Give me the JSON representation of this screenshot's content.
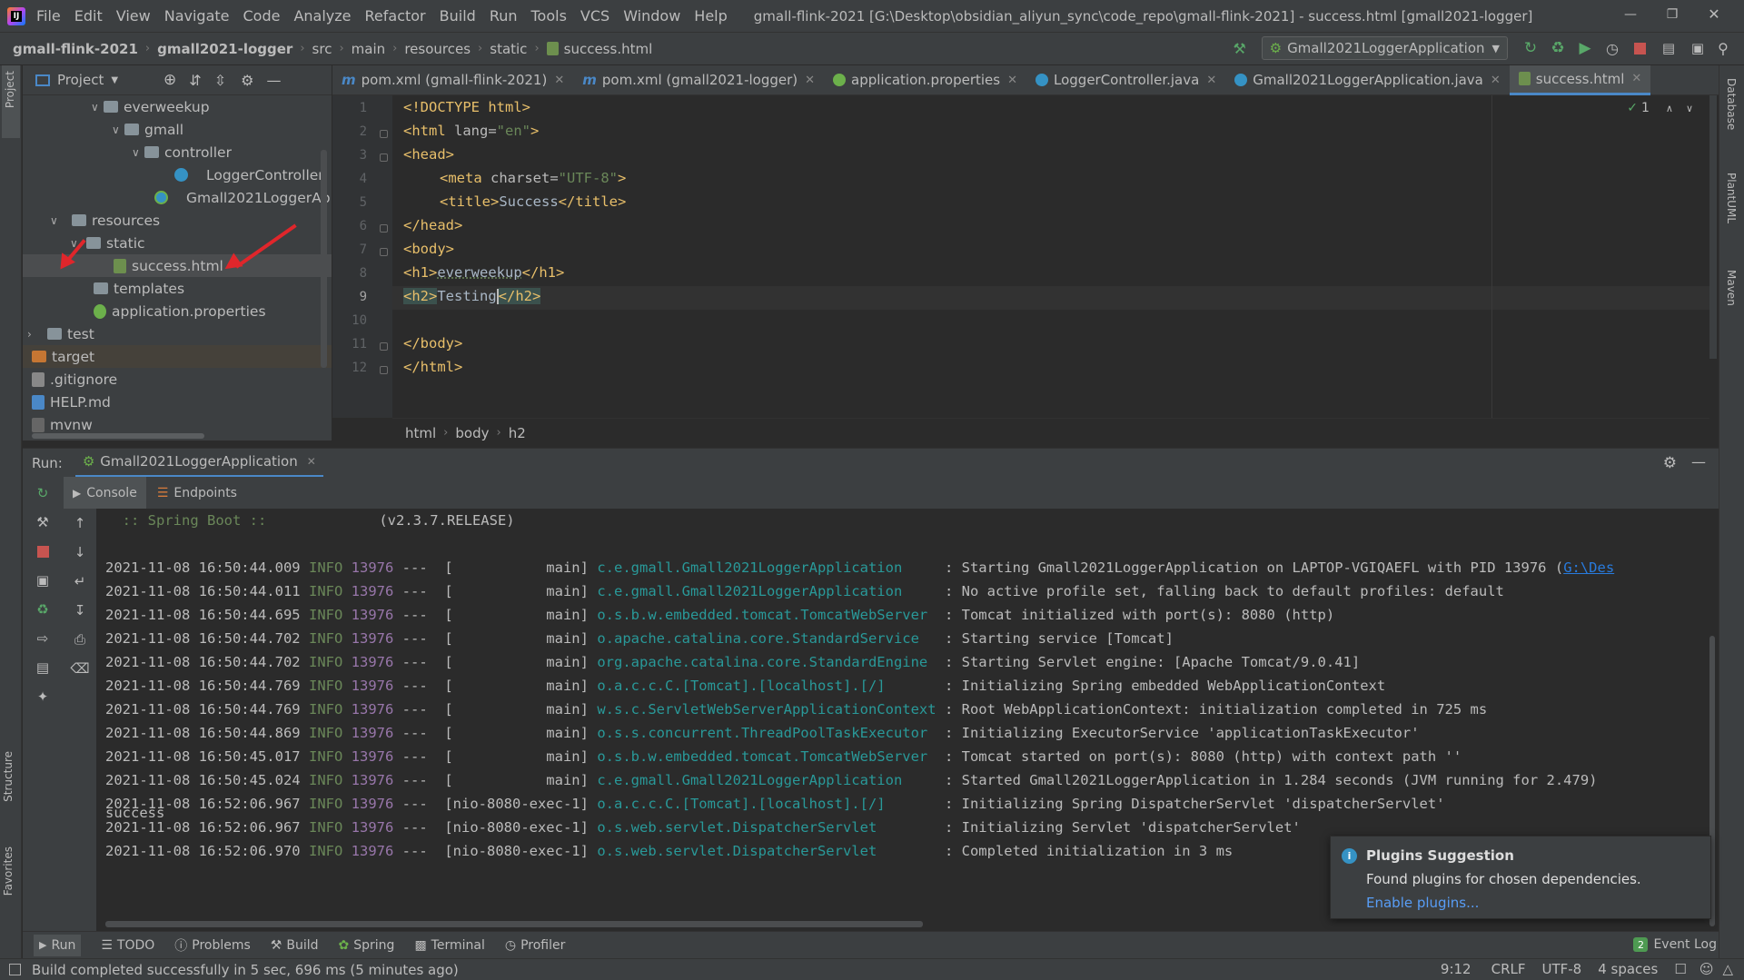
{
  "menu": [
    "File",
    "Edit",
    "View",
    "Navigate",
    "Code",
    "Analyze",
    "Refactor",
    "Build",
    "Run",
    "Tools",
    "VCS",
    "Window",
    "Help"
  ],
  "window_title": "gmall-flink-2021 [G:\\Desktop\\obsidian_aliyun_sync\\code_repo\\gmall-flink-2021] - success.html [gmall2021-logger]",
  "breadcrumb": [
    "gmall-flink-2021",
    "gmall2021-logger",
    "src",
    "main",
    "resources",
    "static",
    "success.html"
  ],
  "run_config": "Gmall2021LoggerApplication",
  "project": {
    "title": "Project",
    "tree": [
      {
        "label": "everweekup",
        "kind": "folder"
      },
      {
        "label": "gmall",
        "kind": "folder"
      },
      {
        "label": "controller",
        "kind": "folder"
      },
      {
        "label": "LoggerController",
        "kind": "class"
      },
      {
        "label": "Gmall2021LoggerAp",
        "kind": "class"
      },
      {
        "label": "resources",
        "kind": "folder"
      },
      {
        "label": "static",
        "kind": "folder"
      },
      {
        "label": "success.html",
        "kind": "html"
      },
      {
        "label": "templates",
        "kind": "folder"
      },
      {
        "label": "application.properties",
        "kind": "props"
      },
      {
        "label": "test",
        "kind": "folder"
      },
      {
        "label": "target",
        "kind": "folder-orange"
      },
      {
        "label": ".gitignore",
        "kind": "file"
      },
      {
        "label": "HELP.md",
        "kind": "file"
      },
      {
        "label": "mvnw",
        "kind": "file"
      }
    ]
  },
  "tabs": [
    {
      "label": "pom.xml (gmall-flink-2021)",
      "icon": "m"
    },
    {
      "label": "pom.xml (gmall2021-logger)",
      "icon": "m"
    },
    {
      "label": "application.properties",
      "icon": "props"
    },
    {
      "label": "LoggerController.java",
      "icon": "class"
    },
    {
      "label": "Gmall2021LoggerApplication.java",
      "icon": "class"
    },
    {
      "label": "success.html",
      "icon": "html",
      "active": true
    }
  ],
  "editor": {
    "line_numbers": [
      "1",
      "2",
      "3",
      "4",
      "5",
      "6",
      "7",
      "8",
      "9",
      "10",
      "11",
      "12"
    ],
    "problems_count": "1",
    "breadcrumb": [
      "html",
      "body",
      "h2"
    ]
  },
  "code": {
    "l1": "<!DOCTYPE html>",
    "l2_open": "<html ",
    "l2_attr": "lang=",
    "l2_val": "\"en\"",
    "l2_close": ">",
    "l3": "<head>",
    "l4_open": "<meta ",
    "l4_attr": "charset=",
    "l4_val": "\"UTF-8\"",
    "l4_close": ">",
    "l5_open": "<title>",
    "l5_text": "Success",
    "l5_close": "</title>",
    "l6": "</head>",
    "l7": "<body>",
    "l8_open": "<h1>",
    "l8_text": "everweekup",
    "l8_close": "</h1>",
    "l9_open": "<h2>",
    "l9_text": "Testing",
    "l9_close": "</h2>",
    "l11": "</body>",
    "l12": "</html>"
  },
  "run": {
    "label": "Run:",
    "config_tab": "Gmall2021LoggerApplication",
    "tabs": [
      "Console",
      "Endpoints"
    ],
    "banner_left": "  :: Spring Boot ::",
    "banner_right": "(v2.3.7.RELEASE)",
    "logs": [
      {
        "ts": "2021-11-08 16:50:44.009",
        "lv": "INFO",
        "pid": "13976",
        "th": "---  [           main]",
        "lg": "c.e.gmall.Gmall2021LoggerApplication    ",
        "msg": ": Starting Gmall2021LoggerApplication on LAPTOP-VGIQAEFL with PID 13976 (",
        "link": "G:\\Des"
      },
      {
        "ts": "2021-11-08 16:50:44.011",
        "lv": "INFO",
        "pid": "13976",
        "th": "---  [           main]",
        "lg": "c.e.gmall.Gmall2021LoggerApplication    ",
        "msg": ": No active profile set, falling back to default profiles: default",
        "link": ""
      },
      {
        "ts": "2021-11-08 16:50:44.695",
        "lv": "INFO",
        "pid": "13976",
        "th": "---  [           main]",
        "lg": "o.s.b.w.embedded.tomcat.TomcatWebServer ",
        "msg": ": Tomcat initialized with port(s): 8080 (http)",
        "link": ""
      },
      {
        "ts": "2021-11-08 16:50:44.702",
        "lv": "INFO",
        "pid": "13976",
        "th": "---  [           main]",
        "lg": "o.apache.catalina.core.StandardService  ",
        "msg": ": Starting service [Tomcat]",
        "link": ""
      },
      {
        "ts": "2021-11-08 16:50:44.702",
        "lv": "INFO",
        "pid": "13976",
        "th": "---  [           main]",
        "lg": "org.apache.catalina.core.StandardEngine ",
        "msg": ": Starting Servlet engine: [Apache Tomcat/9.0.41]",
        "link": ""
      },
      {
        "ts": "2021-11-08 16:50:44.769",
        "lv": "INFO",
        "pid": "13976",
        "th": "---  [           main]",
        "lg": "o.a.c.c.C.[Tomcat].[localhost].[/]      ",
        "msg": ": Initializing Spring embedded WebApplicationContext",
        "link": ""
      },
      {
        "ts": "2021-11-08 16:50:44.769",
        "lv": "INFO",
        "pid": "13976",
        "th": "---  [           main]",
        "lg": "w.s.c.ServletWebServerApplicationContext",
        "msg": ": Root WebApplicationContext: initialization completed in 725 ms",
        "link": ""
      },
      {
        "ts": "2021-11-08 16:50:44.869",
        "lv": "INFO",
        "pid": "13976",
        "th": "---  [           main]",
        "lg": "o.s.s.concurrent.ThreadPoolTaskExecutor ",
        "msg": ": Initializing ExecutorService 'applicationTaskExecutor'",
        "link": ""
      },
      {
        "ts": "2021-11-08 16:50:45.017",
        "lv": "INFO",
        "pid": "13976",
        "th": "---  [           main]",
        "lg": "o.s.b.w.embedded.tomcat.TomcatWebServer ",
        "msg": ": Tomcat started on port(s): 8080 (http) with context path ''",
        "link": ""
      },
      {
        "ts": "2021-11-08 16:50:45.024",
        "lv": "INFO",
        "pid": "13976",
        "th": "---  [           main]",
        "lg": "c.e.gmall.Gmall2021LoggerApplication    ",
        "msg": ": Started Gmall2021LoggerApplication in 1.284 seconds (JVM running for 2.479)",
        "link": ""
      },
      {
        "ts": "2021-11-08 16:52:06.967",
        "lv": "INFO",
        "pid": "13976",
        "th": "---  [nio-8080-exec-1]",
        "lg": "o.a.c.c.C.[Tomcat].[localhost].[/]      ",
        "msg": ": Initializing Spring DispatcherServlet 'dispatcherServlet'",
        "link": ""
      },
      {
        "ts": "2021-11-08 16:52:06.967",
        "lv": "INFO",
        "pid": "13976",
        "th": "---  [nio-8080-exec-1]",
        "lg": "o.s.web.servlet.DispatcherServlet       ",
        "msg": ": Initializing Servlet 'dispatcherServlet'",
        "link": ""
      },
      {
        "ts": "2021-11-08 16:52:06.970",
        "lv": "INFO",
        "pid": "13976",
        "th": "---  [nio-8080-exec-1]",
        "lg": "o.s.web.servlet.DispatcherServlet       ",
        "msg": ": Completed initialization in 3 ms",
        "link": ""
      }
    ],
    "last_line": "success"
  },
  "notification": {
    "title": "Plugins Suggestion",
    "body": "Found plugins for chosen dependencies.",
    "action": "Enable plugins..."
  },
  "bottom_tools": [
    "Run",
    "TODO",
    "Problems",
    "Build",
    "Spring",
    "Terminal",
    "Profiler"
  ],
  "event_log": {
    "count": "2",
    "label": "Event Log"
  },
  "status": {
    "message": "Build completed successfully in 5 sec, 696 ms (5 minutes ago)",
    "position": "9:12",
    "line_sep": "CRLF",
    "encoding": "UTF-8",
    "indent": "4 spaces"
  },
  "side_labels": {
    "left": [
      "Project",
      "Structure",
      "Favorites"
    ],
    "right": [
      "Database",
      "PlantUML",
      "Maven"
    ]
  },
  "colors": {
    "accent": "#4a88c7",
    "arrow": "#e0262b",
    "tag": "#e8bf6a",
    "string": "#6a8759",
    "logger": "#299999"
  }
}
